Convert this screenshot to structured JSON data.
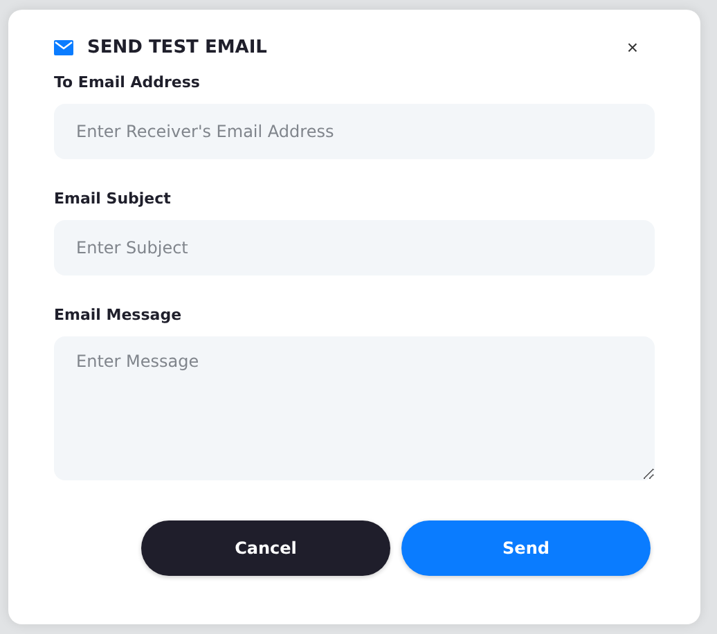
{
  "dialog": {
    "title": "SEND TEST EMAIL",
    "close": "×"
  },
  "fields": [
    {
      "kind": "input",
      "label": "To Email Address",
      "placeholder": "Enter Receiver's Email Address"
    },
    {
      "kind": "input",
      "label": "Email Subject",
      "placeholder": "Enter Subject"
    },
    {
      "kind": "textarea",
      "label": "Email Message",
      "placeholder": "Enter Message"
    }
  ],
  "buttons": [
    {
      "kind": "secondary",
      "label": "Cancel"
    },
    {
      "kind": "primary",
      "label": "Send"
    }
  ]
}
